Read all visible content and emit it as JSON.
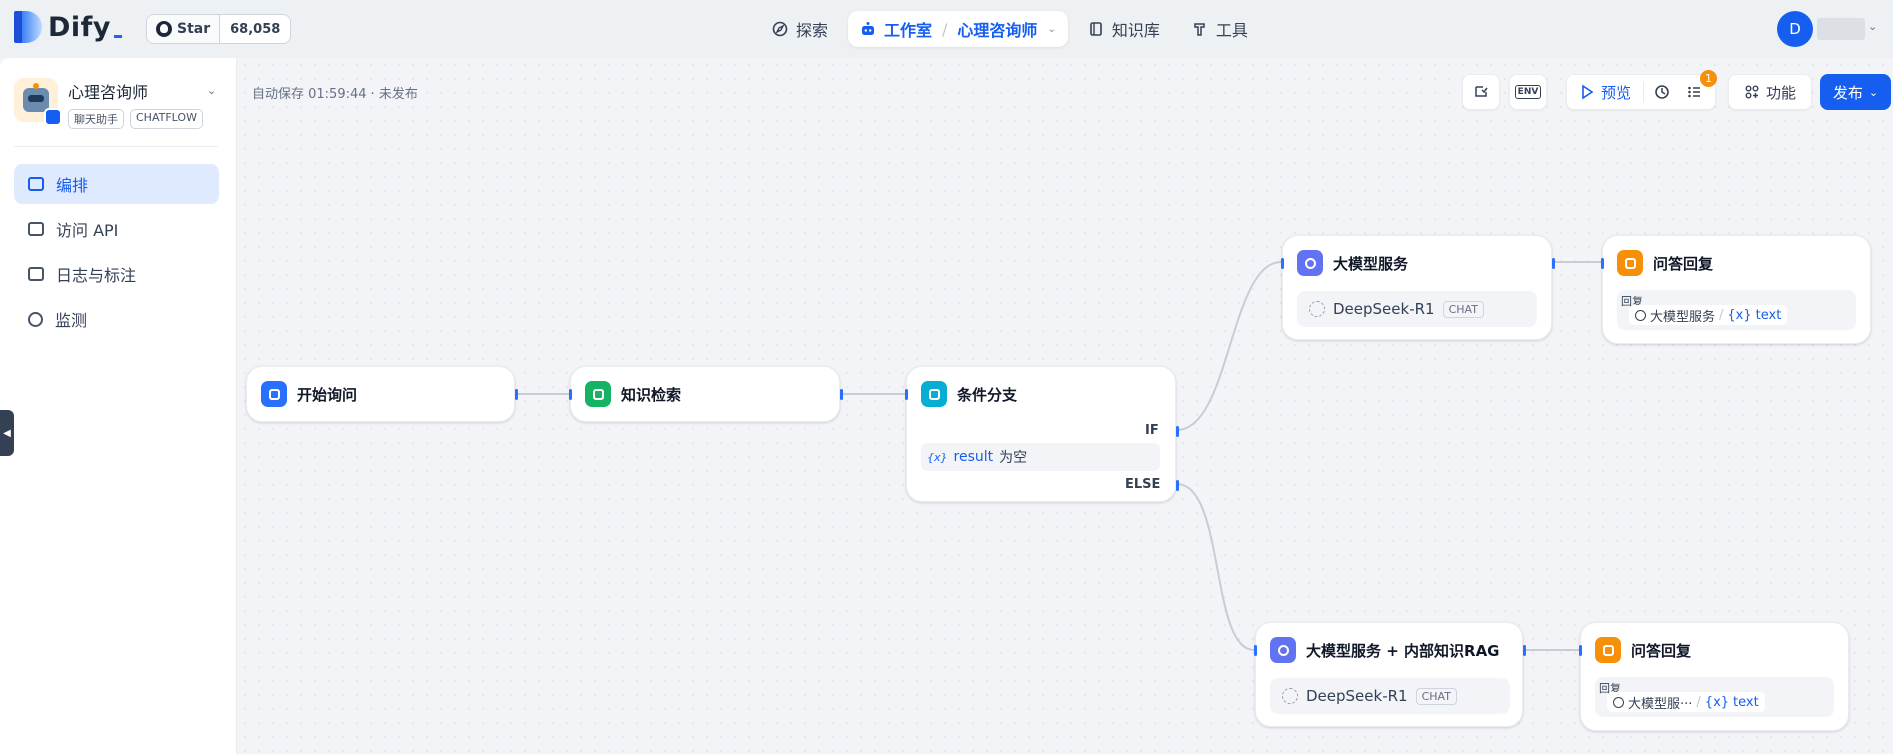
{
  "header": {
    "logo_text": "Dify",
    "github": {
      "star_label": "Star",
      "count": "68,058"
    },
    "nav": {
      "explore": "探索",
      "studio": "工作室",
      "studio_sep": "/",
      "current_app": "心理咨询师",
      "knowledge": "知识库",
      "tools": "工具"
    },
    "avatar_initial": "D"
  },
  "sidebar": {
    "app_name": "心理咨询师",
    "tags": [
      "聊天助手",
      "CHATFLOW"
    ],
    "menu": [
      {
        "label": "编排",
        "active": true
      },
      {
        "label": "访问 API"
      },
      {
        "label": "日志与标注"
      },
      {
        "label": "监测"
      }
    ]
  },
  "toolbar": {
    "autosave": "自动保存 01:59:44 · 未发布",
    "env_label": "ENV",
    "preview": "预览",
    "notification_count": "1",
    "features": "功能",
    "publish": "发布"
  },
  "nodes": {
    "start": {
      "title": "开始询问",
      "color": "#2970ff"
    },
    "knowledge": {
      "title": "知识检索",
      "color": "#16b364"
    },
    "ifelse": {
      "title": "条件分支",
      "color": "#06aed4",
      "if_label": "IF",
      "else_label": "ELSE",
      "cond_var_prefix": "{x}",
      "cond_var": "result",
      "cond_op": "为空"
    },
    "llm1": {
      "title": "大模型服务",
      "color": "#6172f3",
      "model": "DeepSeek-R1",
      "mode": "CHAT"
    },
    "answer1": {
      "title": "问答回复",
      "color": "#f79009",
      "reply_label": "回复",
      "source": "大模型服务",
      "var_prefix": "{x}",
      "var": "text"
    },
    "llm2": {
      "title": "大模型服务 + 内部知识RAG",
      "color": "#6172f3",
      "model": "DeepSeek-R1",
      "mode": "CHAT"
    },
    "answer2": {
      "title": "问答回复",
      "color": "#f79009",
      "reply_label": "回复",
      "source": "大模型服···",
      "var_prefix": "{x}",
      "var": "text"
    }
  }
}
